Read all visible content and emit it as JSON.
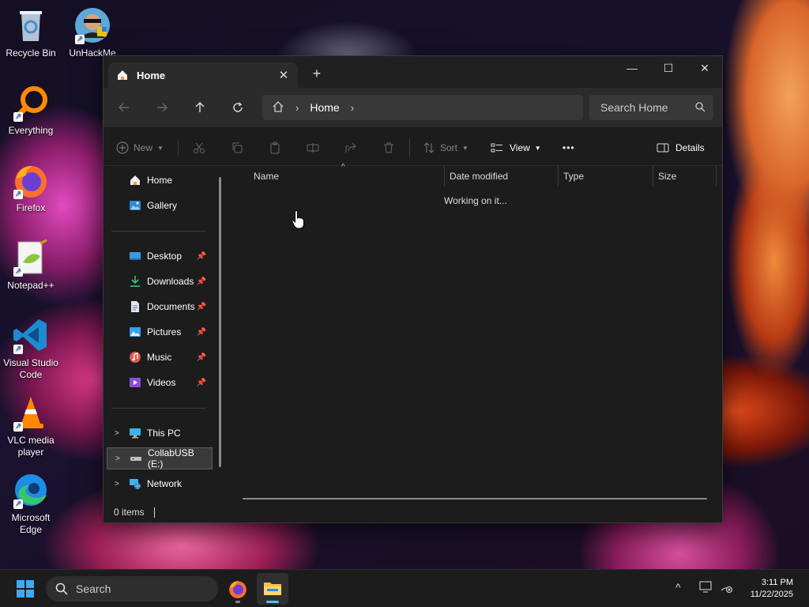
{
  "desktop": {
    "icons": [
      {
        "label": "Recycle Bin"
      },
      {
        "label": "UnHackMe"
      },
      {
        "label": "Everything"
      },
      {
        "label": "Firefox"
      },
      {
        "label": "Notepad++"
      },
      {
        "label": "Visual Studio Code"
      },
      {
        "label": "VLC media player"
      },
      {
        "label": "Microsoft Edge"
      }
    ]
  },
  "window": {
    "tab_title": "Home",
    "tab_close": "✕",
    "new_tab": "+",
    "controls": {
      "minimize": "—",
      "maximize": "☐",
      "close": "✕"
    }
  },
  "navbar": {
    "address_crumb": "Home",
    "search_placeholder": "Search Home"
  },
  "commands": {
    "new": "New",
    "sort": "Sort",
    "view": "View",
    "more": "•••",
    "details": "Details"
  },
  "sidebar": {
    "items": [
      {
        "label": "Home"
      },
      {
        "label": "Gallery"
      },
      {
        "label": "Desktop"
      },
      {
        "label": "Downloads"
      },
      {
        "label": "Documents"
      },
      {
        "label": "Pictures"
      },
      {
        "label": "Music"
      },
      {
        "label": "Videos"
      },
      {
        "label": "This PC"
      },
      {
        "label": "CollabUSB (E:)"
      },
      {
        "label": "Network"
      }
    ]
  },
  "content": {
    "columns": [
      "Name",
      "Date modified",
      "Type",
      "Size"
    ],
    "status_message": "Working on it..."
  },
  "statusbar": {
    "item_count": "0 items"
  },
  "taskbar": {
    "search_label": "Search",
    "time": "3:11 PM",
    "date": "11/22/2025"
  },
  "colors": {
    "accent": "#4cc2ff",
    "window_bg": "#1c1c1c",
    "taskbar_bg": "#1c1c1c"
  }
}
